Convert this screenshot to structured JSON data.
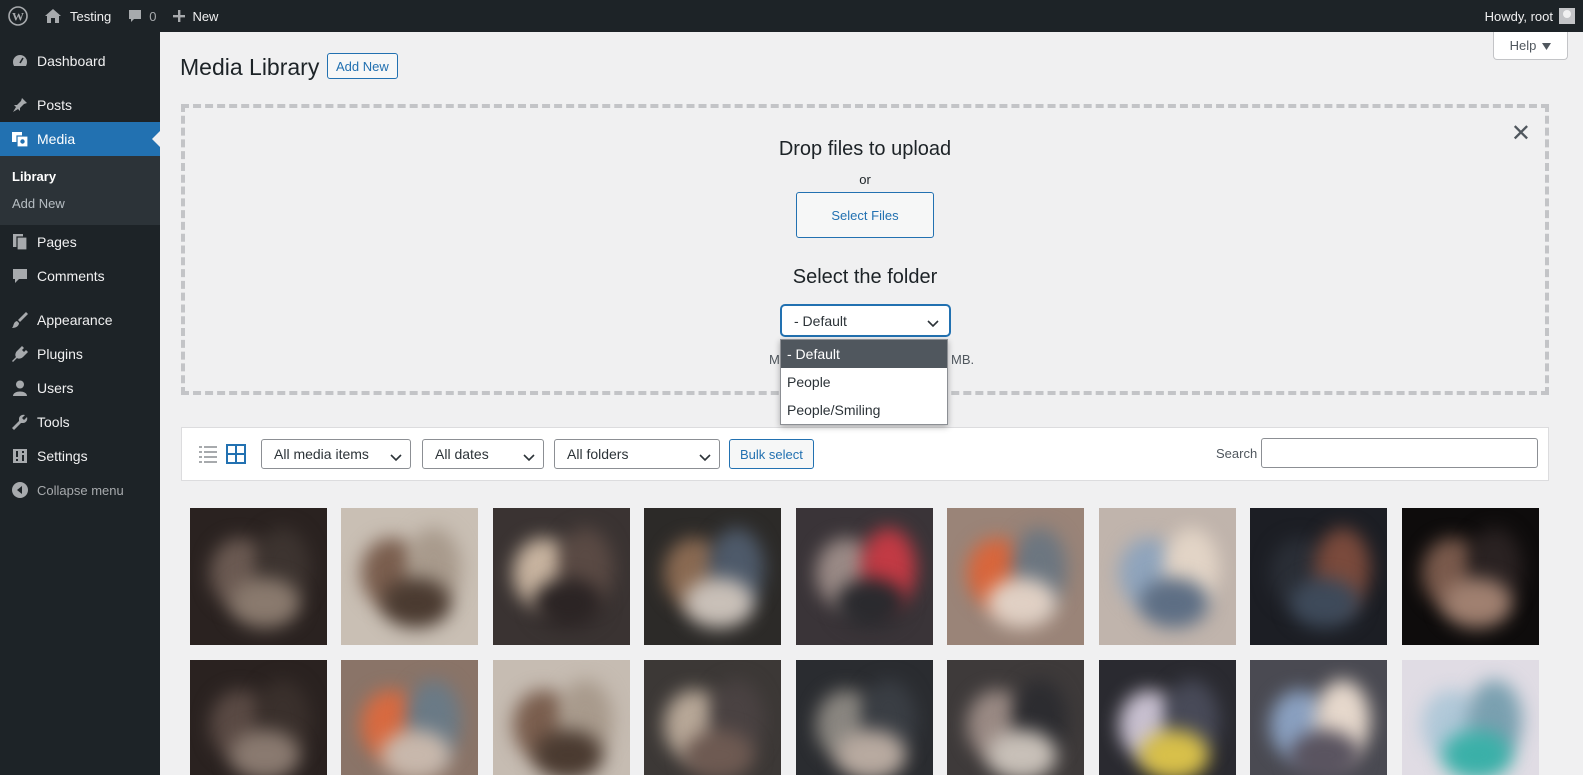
{
  "adminbar": {
    "site_name": "Testing",
    "comments_count": "0",
    "new_label": "New",
    "howdy": "Howdy, root"
  },
  "sidebar": {
    "items": [
      {
        "label": "Dashboard",
        "icon": "dashboard-icon"
      },
      {
        "label": "Posts",
        "icon": "pin-icon"
      },
      {
        "label": "Media",
        "icon": "media-icon"
      },
      {
        "label": "Pages",
        "icon": "pages-icon"
      },
      {
        "label": "Comments",
        "icon": "comment-icon"
      },
      {
        "label": "Appearance",
        "icon": "brush-icon"
      },
      {
        "label": "Plugins",
        "icon": "plugin-icon"
      },
      {
        "label": "Users",
        "icon": "user-icon"
      },
      {
        "label": "Tools",
        "icon": "wrench-icon"
      },
      {
        "label": "Settings",
        "icon": "settings-icon"
      }
    ],
    "submenu": [
      "Library",
      "Add New"
    ],
    "collapse_label": "Collapse menu"
  },
  "header": {
    "title": "Media Library",
    "add_new_label": "Add New",
    "help_label": "Help"
  },
  "uploader": {
    "drop_title": "Drop files to upload",
    "or_text": "or",
    "select_files_label": "Select Files",
    "folder_title": "Select the folder",
    "folder_selected": "- Default",
    "folder_options": [
      "- Default",
      "People",
      "People/Smiling"
    ],
    "maxsize_left": "M",
    "maxsize_right": "MB."
  },
  "toolbar": {
    "media_type": "All media items",
    "dates": "All dates",
    "folders": "All folders",
    "bulk_select_label": "Bulk select",
    "search_label": "Search",
    "search_value": ""
  },
  "colors": {
    "admin_dark": "#1d2327",
    "accent": "#2271b1",
    "background": "#f0f0f1"
  },
  "media_grid": {
    "thumbnails": [
      {
        "name": "media-thumbnail-1"
      },
      {
        "name": "media-thumbnail-2"
      },
      {
        "name": "media-thumbnail-3"
      },
      {
        "name": "media-thumbnail-4"
      },
      {
        "name": "media-thumbnail-5"
      },
      {
        "name": "media-thumbnail-6"
      },
      {
        "name": "media-thumbnail-7"
      },
      {
        "name": "media-thumbnail-8"
      },
      {
        "name": "media-thumbnail-9"
      },
      {
        "name": "media-thumbnail-10"
      },
      {
        "name": "media-thumbnail-11"
      },
      {
        "name": "media-thumbnail-12"
      },
      {
        "name": "media-thumbnail-13"
      },
      {
        "name": "media-thumbnail-14"
      },
      {
        "name": "media-thumbnail-15"
      },
      {
        "name": "media-thumbnail-16"
      },
      {
        "name": "media-thumbnail-17"
      },
      {
        "name": "media-thumbnail-18"
      }
    ]
  }
}
